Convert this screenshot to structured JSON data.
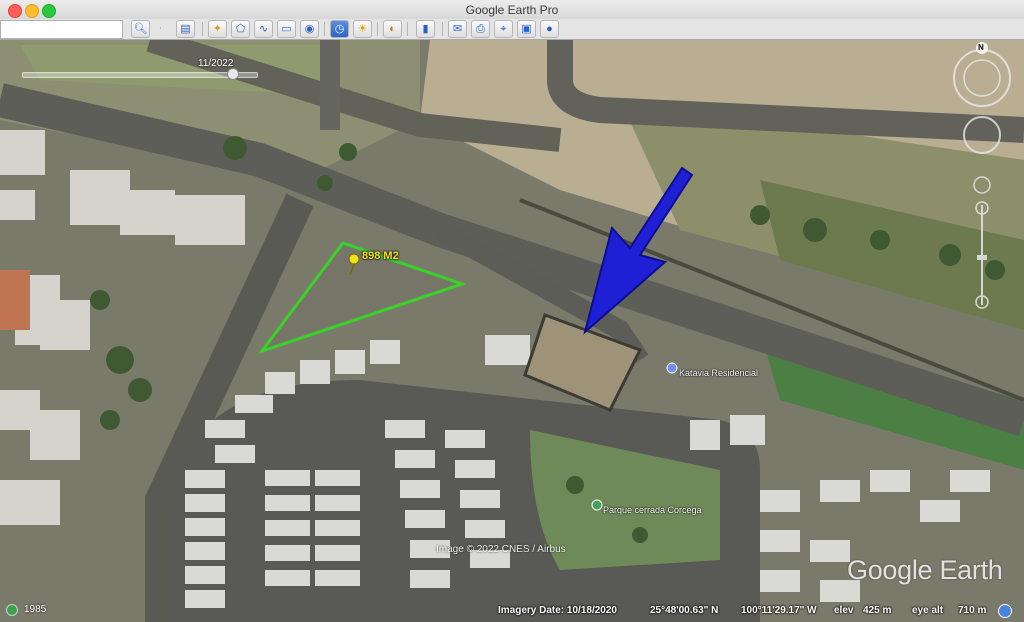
{
  "window": {
    "title": "Google Earth Pro"
  },
  "toolbar": {
    "search_value": "",
    "buttons": [
      {
        "icon": "search-icon"
      },
      {
        "icon": "sidebar-toggle-icon"
      },
      {
        "icon": "placemark-icon"
      },
      {
        "icon": "polygon-icon"
      },
      {
        "icon": "path-icon"
      },
      {
        "icon": "image-overlay-icon"
      },
      {
        "icon": "record-tour-icon"
      },
      {
        "icon": "historical-imagery-icon"
      },
      {
        "icon": "sunlight-icon"
      },
      {
        "icon": "planets-icon"
      },
      {
        "icon": "ruler-icon"
      },
      {
        "icon": "email-icon"
      },
      {
        "icon": "print-icon"
      },
      {
        "icon": "save-image-icon"
      },
      {
        "icon": "view-in-maps-icon"
      },
      {
        "icon": "earth-icon"
      }
    ]
  },
  "map": {
    "time_slider_label": "11/2022",
    "area_label": "898 M2",
    "places": [
      {
        "name": "Katavia Residencial"
      },
      {
        "name": "Parque cerrada Corcega"
      }
    ],
    "copyright": "Image © 2022 CNES / Airbus",
    "logo": "Google Earth",
    "compass_north": "N"
  },
  "statusbar": {
    "history_year": "1985",
    "imagery_date": "Imagery Date: 10/18/2020",
    "lat": "25°48'00.63\" N",
    "lon": "100°11'29.17\" W",
    "elev_label": "elev",
    "elev_value": "425 m",
    "eye_alt_label": "eye alt",
    "eye_alt_value": "710 m"
  },
  "colors": {
    "polygon_outline": "#39d229",
    "arrow": "#1f1fd6",
    "label_yellow": "#f4e11c"
  }
}
